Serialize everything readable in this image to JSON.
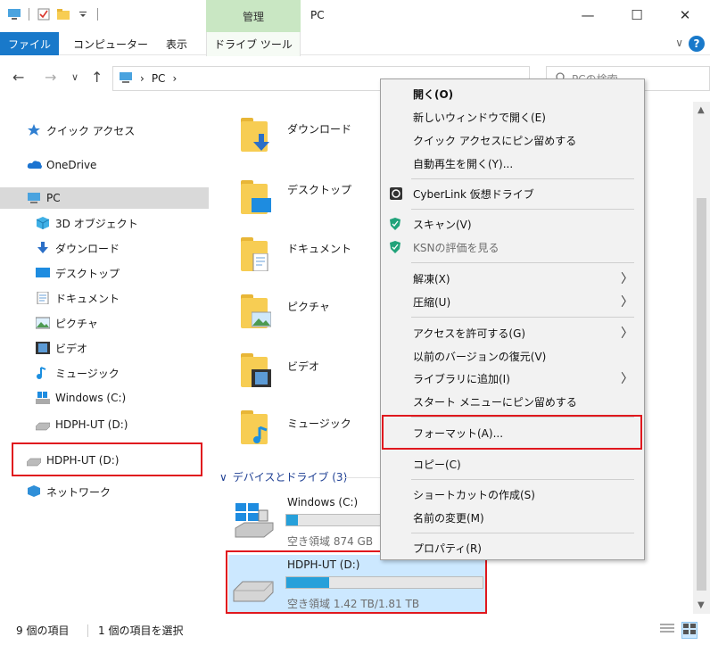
{
  "window": {
    "title": "PC",
    "ribbon_context": "管理",
    "minimize": "—",
    "maximize": "☐",
    "close": "✕"
  },
  "ribbon": {
    "tabs": [
      {
        "label": "ファイル"
      },
      {
        "label": "コンピューター"
      },
      {
        "label": "表示"
      },
      {
        "label": "ドライブ ツール"
      }
    ],
    "help": "?",
    "expand": "∨"
  },
  "address": {
    "back": "←",
    "forward": "→",
    "recent": "∨",
    "up": "↑",
    "path_sep": "›",
    "path": "PC",
    "search_placeholder": "PCの検索"
  },
  "nav": {
    "items": [
      {
        "label": "クイック アクセス"
      },
      {
        "label": "OneDrive"
      },
      {
        "label": "PC"
      },
      {
        "label": "3D オブジェクト"
      },
      {
        "label": "ダウンロード"
      },
      {
        "label": "デスクトップ"
      },
      {
        "label": "ドキュメント"
      },
      {
        "label": "ピクチャ"
      },
      {
        "label": "ビデオ"
      },
      {
        "label": "ミュージック"
      },
      {
        "label": "Windows (C:)"
      },
      {
        "label": "HDPH-UT (D:)"
      },
      {
        "label": "HDPH-UT (D:)"
      },
      {
        "label": "ネットワーク"
      }
    ]
  },
  "folders": [
    {
      "label": "ダウンロード"
    },
    {
      "label": "デスクトップ"
    },
    {
      "label": "ドキュメント"
    },
    {
      "label": "ピクチャ"
    },
    {
      "label": "ビデオ"
    },
    {
      "label": "ミュージック"
    }
  ],
  "devices": {
    "header": "デバイスとドライブ (3)",
    "collapse": "∨",
    "drives": [
      {
        "name": "Windows (C:)",
        "free": "空き領域 874 GB",
        "used_fraction": 0.08
      },
      {
        "name": "HDPH-UT (D:)",
        "free": "空き領域 1.42 TB/1.81 TB",
        "used_fraction": 0.22
      }
    ]
  },
  "context_menu": {
    "items": [
      {
        "label": "開く(O)"
      },
      {
        "label": "新しいウィンドウで開く(E)"
      },
      {
        "label": "クイック アクセスにピン留めする"
      },
      {
        "label": "自動再生を開く(Y)..."
      },
      {
        "label": "CyberLink 仮想ドライブ"
      },
      {
        "label": "スキャン(V)"
      },
      {
        "label": "KSNの評価を見る"
      },
      {
        "label": "解凍(X)"
      },
      {
        "label": "圧縮(U)"
      },
      {
        "label": "アクセスを許可する(G)"
      },
      {
        "label": "以前のバージョンの復元(V)"
      },
      {
        "label": "ライブラリに追加(I)"
      },
      {
        "label": "スタート メニューにピン留めする"
      },
      {
        "label": "フォーマット(A)..."
      },
      {
        "label": "コピー(C)"
      },
      {
        "label": "ショートカットの作成(S)"
      },
      {
        "label": "名前の変更(M)"
      },
      {
        "label": "プロパティ(R)"
      }
    ],
    "submenu_arrow": "〉"
  },
  "status": {
    "count": "9 個の項目",
    "selected": "1 個の項目を選択"
  },
  "colors": {
    "accent": "#1979ca",
    "highlight": "#e0181e",
    "drive_bar": "#26a0da",
    "ribbon_context": "#c9e7c3"
  }
}
